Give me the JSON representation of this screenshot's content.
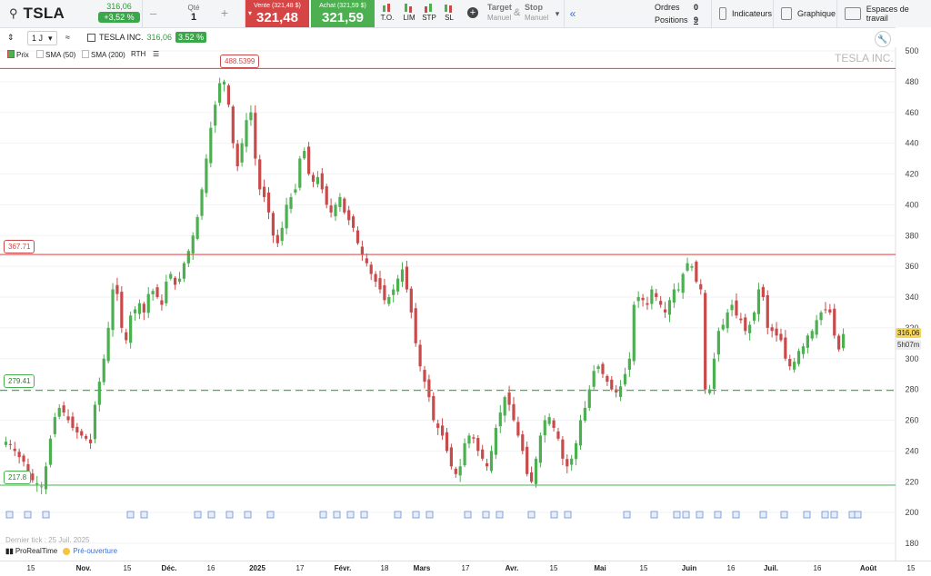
{
  "symbol": {
    "icon": "search-icon",
    "name": "TSLA",
    "price": "316,06",
    "change": "+3,52 %"
  },
  "quantity": {
    "label": "Qté",
    "value": "1",
    "minus": "–",
    "plus": "+"
  },
  "sell": {
    "caption": "Vente (321,48 $)",
    "price": "321,48"
  },
  "buy": {
    "caption": "Achat (321,59 $)",
    "price": "321,59"
  },
  "order_types": [
    {
      "label": "T.O."
    },
    {
      "label": "LIM"
    },
    {
      "label": "STP"
    },
    {
      "label": "SL"
    }
  ],
  "target_stop": {
    "target": "Target",
    "target_mode": "Manuel",
    "amp": "&",
    "stop": "Stop",
    "stop_mode": "Manuel"
  },
  "collapse": "«",
  "orders": {
    "label": "Ordres",
    "value": "0"
  },
  "positions": {
    "label": "Positions",
    "value": "9"
  },
  "menu": {
    "indicators": "Indicateurs",
    "chart": "Graphique",
    "workspaces": "Espaces de travail"
  },
  "toolbar": {
    "interval": "1 J",
    "instrument": "TESLA INC.",
    "last": "316,06",
    "pct": "3.52 %"
  },
  "legend": {
    "price": "Prix",
    "sma50": "SMA (50)",
    "sma200": "SMA (200)",
    "rth": "RTH"
  },
  "watermark": "TESLA INC.",
  "levels": {
    "high": "488.5399",
    "resistance": "367.71",
    "mid": "279.41",
    "low": "217.8"
  },
  "right_axis": {
    "ticks": [
      "500",
      "480",
      "460",
      "440",
      "420",
      "400",
      "380",
      "360",
      "340",
      "320",
      "300",
      "280",
      "260",
      "240",
      "220",
      "200",
      "180"
    ]
  },
  "last_price_label": "316,06",
  "countdown": "5h07m",
  "footer": {
    "last_tick": "Dernier tick : 25 Juil. 2025",
    "brand": "ProRealTime",
    "preopen": "Pré-ouverture"
  },
  "x_axis": [
    "15",
    "Nov.",
    "15",
    "Déc.",
    "16",
    "2025",
    "17",
    "Févr.",
    "18",
    "Mars",
    "17",
    "Avr.",
    "15",
    "Mai",
    "15",
    "Juin",
    "16",
    "Juil.",
    "16",
    "Août",
    "15"
  ],
  "colors": {
    "up": "#4caf50",
    "down": "#c94a4a",
    "resistance": "#d64545",
    "support": "#4caf50"
  },
  "chart_data": {
    "type": "candlestick",
    "ylim": [
      180,
      500
    ],
    "series_up_color": "#4caf50",
    "series_down_color": "#c94a4a",
    "close": [
      246,
      244,
      240,
      236,
      233,
      225,
      221,
      219,
      217,
      230,
      248,
      262,
      268,
      265,
      260,
      255,
      252,
      250,
      248,
      245,
      270,
      285,
      300,
      320,
      345,
      342,
      320,
      312,
      328,
      332,
      336,
      330,
      342,
      344,
      340,
      335,
      350,
      355,
      348,
      352,
      362,
      370,
      380,
      392,
      410,
      430,
      450,
      465,
      479,
      480,
      465,
      440,
      425,
      440,
      455,
      460,
      430,
      410,
      405,
      395,
      380,
      375,
      385,
      400,
      405,
      410,
      430,
      435,
      420,
      415,
      418,
      410,
      400,
      395,
      400,
      405,
      395,
      390,
      385,
      375,
      368,
      362,
      355,
      350,
      345,
      338,
      340,
      345,
      352,
      358,
      345,
      330,
      310,
      295,
      285,
      275,
      260,
      255,
      250,
      240,
      230,
      225,
      230,
      245,
      250,
      248,
      240,
      235,
      230,
      240,
      255,
      265,
      275,
      270,
      260,
      250,
      240,
      225,
      220,
      235,
      250,
      260,
      262,
      255,
      248,
      235,
      230,
      235,
      245,
      260,
      268,
      280,
      292,
      295,
      290,
      285,
      280,
      278,
      282,
      290,
      300,
      335,
      340,
      338,
      335,
      345,
      340,
      335,
      330,
      338,
      345,
      345,
      355,
      362,
      360,
      350,
      345,
      280,
      280,
      300,
      318,
      322,
      330,
      335,
      328,
      325,
      318,
      322,
      330,
      345,
      340,
      320,
      318,
      315,
      312,
      300,
      295,
      298,
      305,
      308,
      315,
      318,
      325,
      330,
      332,
      330,
      315,
      306,
      316
    ]
  }
}
